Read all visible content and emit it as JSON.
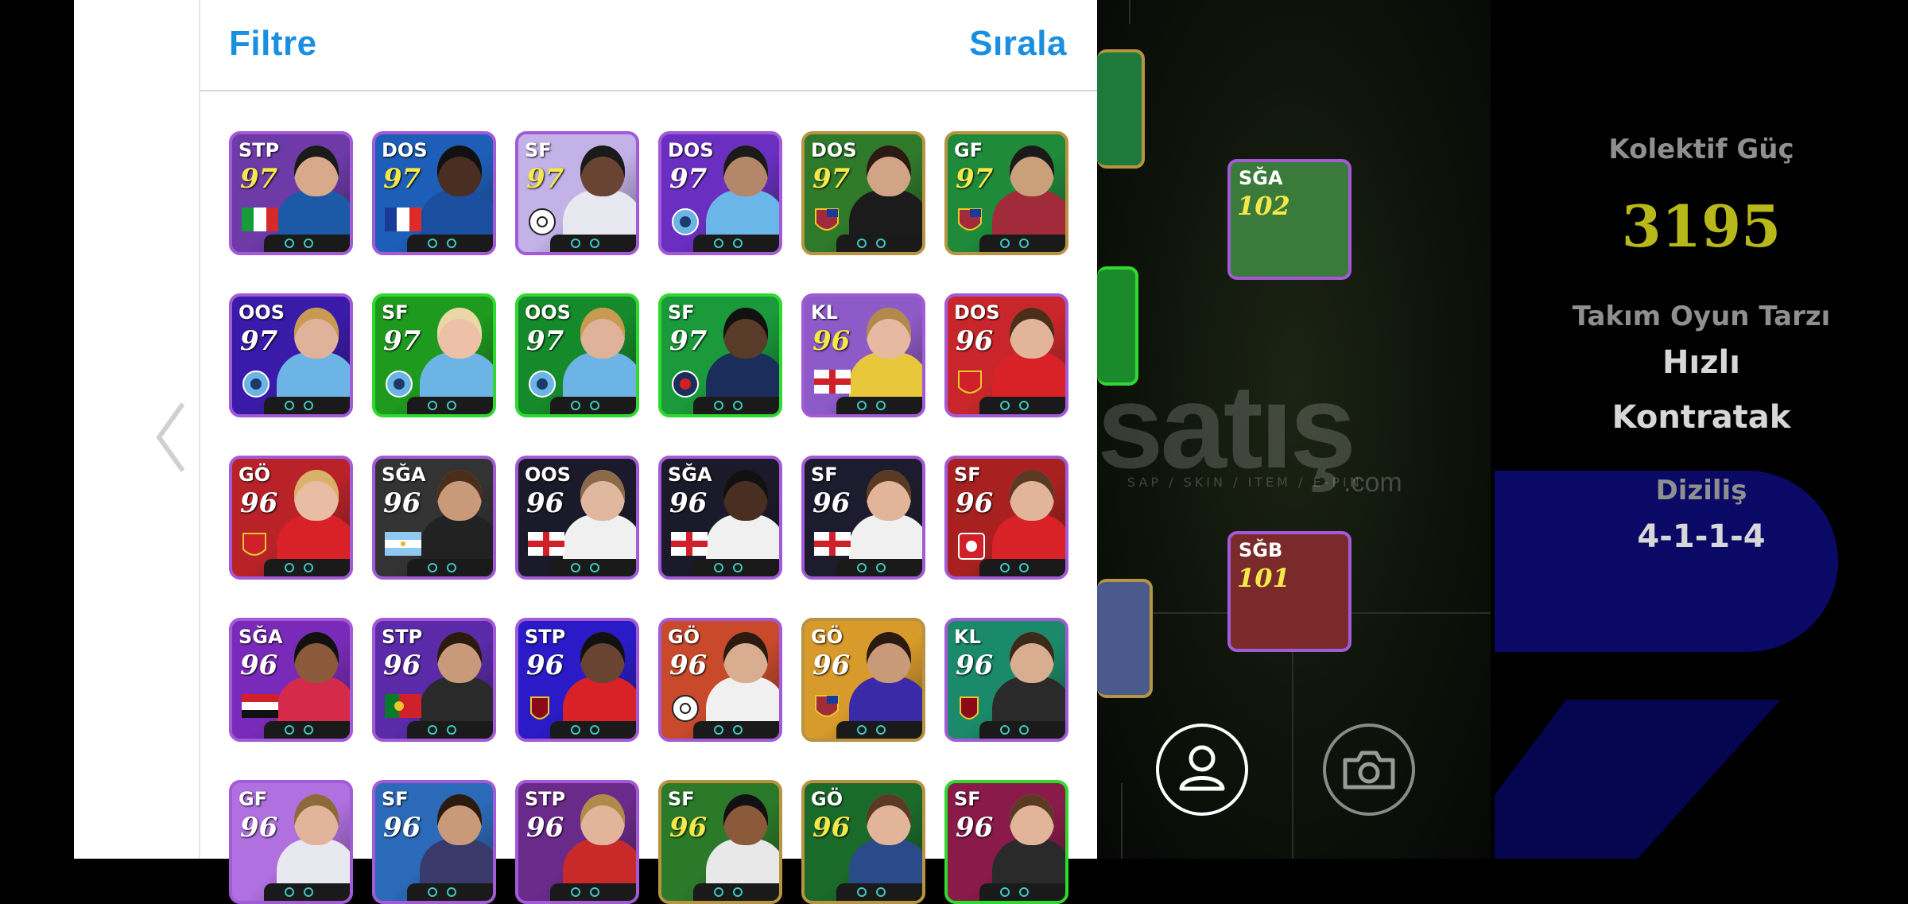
{
  "header": {
    "filter_label": "Filtre",
    "sort_label": "Sırala"
  },
  "icons": {
    "back": "chevron-left-icon",
    "profile": "person-icon",
    "camera": "camera-icon"
  },
  "players": [
    {
      "pos": "STP",
      "rating": "97",
      "flag": "italy",
      "ratingColor": "yellow",
      "border": "#a35ad6",
      "bg": "#6d3aa8",
      "skin": "#d8a98a",
      "kit": "#1c5aa8",
      "hair": "#1a1a1a"
    },
    {
      "pos": "DOS",
      "rating": "97",
      "flag": "france",
      "ratingColor": "yellow",
      "border": "#a35ad6",
      "bg": "#1d5fb8",
      "skin": "#4a2e22",
      "kit": "#1a4e9e",
      "hair": "#111"
    },
    {
      "pos": "SF",
      "rating": "97",
      "flag": "club-white",
      "ratingColor": "yellow",
      "border": "#a35ad6",
      "bg": "#c3b2e8",
      "skin": "#6a4432",
      "kit": "#e8e8f0",
      "hair": "#1a1a1a"
    },
    {
      "pos": "DOS",
      "rating": "97",
      "flag": "club-city",
      "ratingColor": "white",
      "border": "#a35ad6",
      "bg": "#6a2fc0",
      "skin": "#b5876a",
      "kit": "#6bb6e8",
      "hair": "#1a1a1a"
    },
    {
      "pos": "DOS",
      "rating": "97",
      "flag": "club-barca",
      "ratingColor": "yellow",
      "border": "#b79441",
      "bg": "#2f7a2a",
      "skin": "#d2a487",
      "kit": "#1b1b1b",
      "hair": "#2b1a12"
    },
    {
      "pos": "GF",
      "rating": "97",
      "flag": "club-barca",
      "ratingColor": "yellow",
      "border": "#b79441",
      "bg": "#1e8a3a",
      "skin": "#caa07a",
      "kit": "#a12b3a",
      "hair": "#1a1a1a"
    },
    {
      "pos": "OOS",
      "rating": "97",
      "flag": "club-city",
      "ratingColor": "white",
      "border": "#a35ad6",
      "bg": "#3a1aa8",
      "skin": "#e0b29a",
      "kit": "#6cb4e6",
      "hair": "#c99a52"
    },
    {
      "pos": "SF",
      "rating": "97",
      "flag": "club-city",
      "ratingColor": "white",
      "border": "#2fd92f",
      "bg": "#1e9a1e",
      "skin": "#ecc1a8",
      "kit": "#6cb4e6",
      "hair": "#e9d7a5"
    },
    {
      "pos": "OOS",
      "rating": "97",
      "flag": "club-city",
      "ratingColor": "white",
      "border": "#2fd92f",
      "bg": "#158a2a",
      "skin": "#e0b29a",
      "kit": "#6cb4e6",
      "hair": "#c99a52"
    },
    {
      "pos": "SF",
      "rating": "97",
      "flag": "club-psg",
      "ratingColor": "white",
      "border": "#2fd92f",
      "bg": "#1a9a3a",
      "skin": "#5a3a28",
      "kit": "#1b2d5a",
      "hair": "#111"
    },
    {
      "pos": "KL",
      "rating": "96",
      "flag": "england",
      "ratingColor": "yellow",
      "border": "#a35ad6",
      "bg": "#8e5ac8",
      "skin": "#e7b9a0",
      "kit": "#e8c73a",
      "hair": "#b08a4a"
    },
    {
      "pos": "DOS",
      "rating": "96",
      "flag": "club-arsenal",
      "ratingColor": "white",
      "border": "#a35ad6",
      "bg": "#c8262a",
      "skin": "#e2b59a",
      "kit": "#d92128",
      "hair": "#4a2e1a"
    },
    {
      "pos": "GÖ",
      "rating": "96",
      "flag": "club-arsenal",
      "ratingColor": "white",
      "border": "#a35ad6",
      "bg": "#b82228",
      "skin": "#e9bca4",
      "kit": "#d92128",
      "hair": "#d9b26a"
    },
    {
      "pos": "SĞA",
      "rating": "96",
      "flag": "argentina",
      "ratingColor": "white",
      "border": "#a35ad6",
      "bg": "#333",
      "skin": "#c99a7a",
      "kit": "#222",
      "hair": "#4a2e1a"
    },
    {
      "pos": "OOS",
      "rating": "96",
      "flag": "england",
      "ratingColor": "white",
      "border": "#a35ad6",
      "bg": "#1a1a2a",
      "skin": "#e0b8a0",
      "kit": "#f0f0f0",
      "hair": "#8a6a4a"
    },
    {
      "pos": "SĞA",
      "rating": "96",
      "flag": "england",
      "ratingColor": "white",
      "border": "#a35ad6",
      "bg": "#1a1a2a",
      "skin": "#4a2e22",
      "kit": "#f0f0f0",
      "hair": "#111"
    },
    {
      "pos": "SF",
      "rating": "96",
      "flag": "england",
      "ratingColor": "white",
      "border": "#a35ad6",
      "bg": "#1c1c2e",
      "skin": "#e2b49a",
      "kit": "#f0f0f0",
      "hair": "#5a3a22"
    },
    {
      "pos": "SF",
      "rating": "96",
      "flag": "club-bayern",
      "ratingColor": "white",
      "border": "#a35ad6",
      "bg": "#a82020",
      "skin": "#e2b49a",
      "kit": "#d92128",
      "hair": "#5a3a22"
    },
    {
      "pos": "SĞA",
      "rating": "96",
      "flag": "egypt",
      "ratingColor": "white",
      "border": "#a35ad6",
      "bg": "#7a2ab8",
      "skin": "#8a5a3a",
      "kit": "#d62a4a",
      "hair": "#111"
    },
    {
      "pos": "STP",
      "rating": "96",
      "flag": "portugal",
      "ratingColor": "white",
      "border": "#a35ad6",
      "bg": "#5a2aa8",
      "skin": "#c99a7a",
      "kit": "#2a2a2a",
      "hair": "#2a1a10"
    },
    {
      "pos": "STP",
      "rating": "96",
      "flag": "club-liverpool",
      "ratingColor": "white",
      "border": "#a35ad6",
      "bg": "#2a1ac8",
      "skin": "#6a4432",
      "kit": "#d92128",
      "hair": "#111"
    },
    {
      "pos": "GÖ",
      "rating": "96",
      "flag": "club-white",
      "ratingColor": "white",
      "border": "#a35ad6",
      "bg": "#c84a2a",
      "skin": "#d8ad90",
      "kit": "#f0f0f0",
      "hair": "#2a1a10"
    },
    {
      "pos": "GÖ",
      "rating": "96",
      "flag": "club-barca",
      "ratingColor": "white",
      "border": "#b79441",
      "bg": "#d89a2a",
      "skin": "#c99a7a",
      "kit": "#3a2aa8",
      "hair": "#2a1a10"
    },
    {
      "pos": "KL",
      "rating": "96",
      "flag": "club-liverpool",
      "ratingColor": "white",
      "border": "#a35ad6",
      "bg": "#1a8a6a",
      "skin": "#d8ad90",
      "kit": "#2a2a2a",
      "hair": "#3a2a1a"
    },
    {
      "pos": "GF",
      "rating": "96",
      "flag": "none",
      "ratingColor": "white",
      "border": "#a35ad6",
      "bg": "#b070e0",
      "skin": "#e2b49a",
      "kit": "#e8e8f0",
      "hair": "#8a6a3a"
    },
    {
      "pos": "SF",
      "rating": "96",
      "flag": "none",
      "ratingColor": "white",
      "border": "#a35ad6",
      "bg": "#2a6ab8",
      "skin": "#c99a7a",
      "kit": "#3a3a6a",
      "hair": "#2a1a10"
    },
    {
      "pos": "STP",
      "rating": "96",
      "flag": "none",
      "ratingColor": "white",
      "border": "#a35ad6",
      "bg": "#6a2a8a",
      "skin": "#e2b49a",
      "kit": "#c82a2a",
      "hair": "#b08a4a"
    },
    {
      "pos": "SF",
      "rating": "96",
      "flag": "none",
      "ratingColor": "yellow",
      "border": "#b79441",
      "bg": "#2a7a2a",
      "skin": "#8a5a3a",
      "kit": "#e8e8e8",
      "hair": "#111"
    },
    {
      "pos": "GÖ",
      "rating": "96",
      "flag": "none",
      "ratingColor": "yellow",
      "border": "#b79441",
      "bg": "#1a6a2a",
      "skin": "#e2b49a",
      "kit": "#2a4a8a",
      "hair": "#5a3a22"
    },
    {
      "pos": "SF",
      "rating": "96",
      "flag": "none",
      "ratingColor": "white",
      "border": "#2fd92f",
      "bg": "#8a1a4a",
      "skin": "#e2b49a",
      "kit": "#2a2a2a",
      "hair": "#5a3a22"
    }
  ],
  "formation_cards": [
    {
      "pos": "SĞA",
      "rating": "102"
    },
    {
      "pos": "SĞB",
      "rating": "101"
    }
  ],
  "watermark": {
    "brand": "satış",
    "sub": "SAP / SKIN / ITEM / E-PIN",
    "domain": ".com"
  },
  "stats": {
    "team_strength_label": "Kolektif Güç",
    "team_strength_value": "3195",
    "play_style_label": "Takım Oyun Tarzı",
    "play_style_line1": "Hızlı",
    "play_style_line2": "Kontratak",
    "formation_label": "Diziliş",
    "formation_value": "4-1-1-4"
  },
  "colors": {
    "accent": "#1a8fe0",
    "strength": "#b8b81a"
  }
}
